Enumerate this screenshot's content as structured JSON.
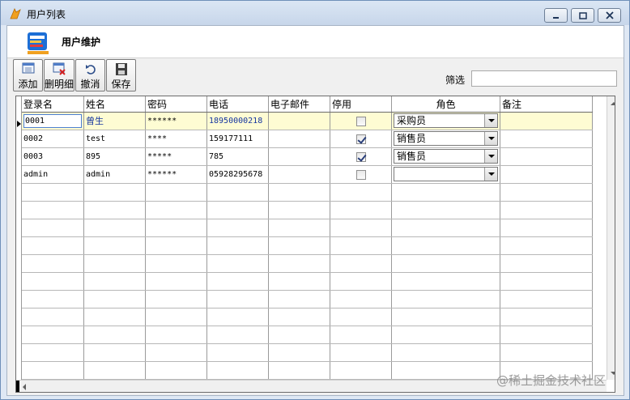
{
  "window": {
    "title": "用户列表"
  },
  "header": {
    "title": "用户维护"
  },
  "toolbar": {
    "add_label": "添加",
    "delete_detail_label": "删明细",
    "undo_label": "撤消",
    "save_label": "保存"
  },
  "filter": {
    "label": "筛选",
    "value": ""
  },
  "grid": {
    "columns": [
      "登录名",
      "姓名",
      "密码",
      "电话",
      "电子邮件",
      "停用",
      "角色",
      "备注"
    ],
    "rows": [
      {
        "login": "0001",
        "name": "曾生",
        "password": "******",
        "phone": "18950000218",
        "email": "",
        "disabled": false,
        "role": "采购员",
        "note": ""
      },
      {
        "login": "0002",
        "name": "test",
        "password": "****",
        "phone": "159177111",
        "email": "",
        "disabled": true,
        "role": "销售员",
        "note": ""
      },
      {
        "login": "0003",
        "name": "895",
        "password": "*****",
        "phone": "785",
        "email": "",
        "disabled": true,
        "role": "销售员",
        "note": ""
      },
      {
        "login": "admin",
        "name": "admin",
        "password": "******",
        "phone": "05928295678",
        "email": "",
        "disabled": false,
        "role": "",
        "note": ""
      }
    ]
  },
  "watermark": "@稀土掘金技术社区"
}
